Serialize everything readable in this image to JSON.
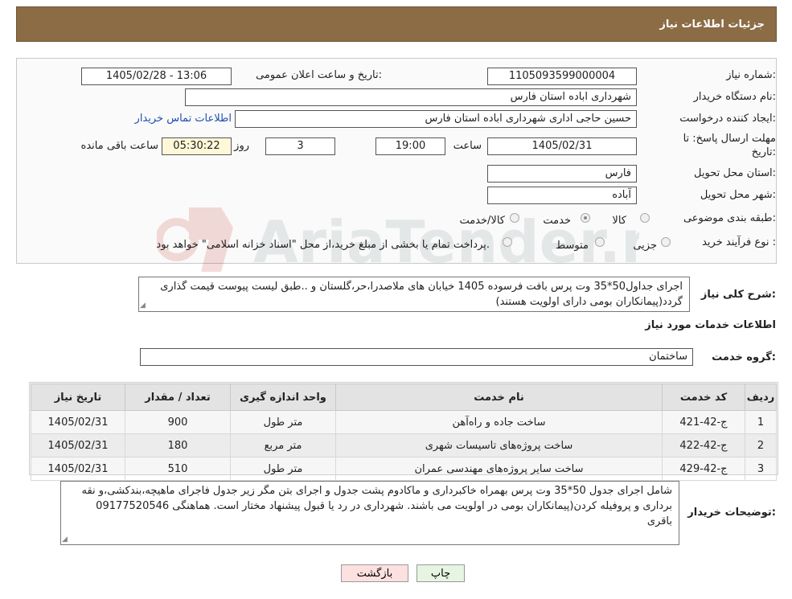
{
  "header": {
    "title": "جزئیات اطلاعات نیاز"
  },
  "need": {
    "number_label": "شماره نیاز:",
    "number_value": "1105093599000004",
    "announce_label": "تاریخ و ساعت اعلان عمومی:",
    "announce_value": "1405/02/28 - 13:06",
    "buyer_label": "نام دستگاه خریدار:",
    "buyer_value": "شهرداری اباده استان فارس",
    "creator_label": "ایجاد کننده درخواست:",
    "creator_value": "حسین حاجی اداری شهرداری اباده استان فارس",
    "contact_link": "اطلاعات تماس خریدار",
    "deadline_label_1": "مهلت ارسال پاسخ: تا",
    "deadline_label_2": "تاریخ:",
    "deadline_date": "1405/02/31",
    "time_label": "ساعت",
    "deadline_time": "19:00",
    "days_value": "3",
    "days_label": "روز و",
    "remaining_value": "05:30:22",
    "remaining_label": "ساعت باقی مانده",
    "province_label": "استان محل تحویل:",
    "province_value": "فارس",
    "city_label": "شهر محل تحویل:",
    "city_value": "آباده",
    "category_label": "طبقه بندی موضوعی:",
    "category_options": [
      "کالا",
      "خدمت",
      "کالا/خدمت"
    ],
    "category_selected": "خدمت",
    "process_label": "نوع فرآیند خرید :",
    "process_options": [
      "جزیی",
      "متوسط"
    ],
    "process_note": "پرداخت تمام یا بخشی از مبلغ خرید،از محل \"اسناد خزانه اسلامی\" خواهد بود."
  },
  "summary": {
    "label": "شرح کلی نیاز:",
    "value": "اجرای جداول50*35 وت پرس بافت فرسوده 1405 خیابان های ملاصدرا،حر،گلستان و ..طبق لیست پیوست قیمت گذاری گردد(پیمانکاران بومی دارای اولویت هستند)"
  },
  "services": {
    "section_title": "اطلاعات خدمات مورد نیاز",
    "group_label": "گروه خدمت:",
    "group_value": "ساختمان",
    "columns": [
      "ردیف",
      "کد خدمت",
      "نام خدمت",
      "واحد اندازه گیری",
      "تعداد / مقدار",
      "تاریخ نیاز"
    ],
    "rows": [
      {
        "index": "1",
        "code": "ج-42-421",
        "name": "ساخت جاده و راه‌آهن",
        "unit": "متر طول",
        "qty": "900",
        "date": "1405/02/31"
      },
      {
        "index": "2",
        "code": "ج-42-422",
        "name": "ساخت پروژه‌های تاسیسات شهری",
        "unit": "متر مربع",
        "qty": "180",
        "date": "1405/02/31"
      },
      {
        "index": "3",
        "code": "ج-42-429",
        "name": "ساخت سایر پروژه‌های مهندسی عمران",
        "unit": "متر طول",
        "qty": "510",
        "date": "1405/02/31"
      }
    ]
  },
  "buyer_notes": {
    "label": "توضیحات خریدار:",
    "value": "شامل اجرای جدول 50*35 وت پرس بهمراه خاکبرداری و ماکادوم پشت جدول و اجرای بتن مگر زیر جدول فاجرای ماهیچه،بندکشی،و نقه برداری و پروفیله کردن(پیمانکاران بومی در اولویت می باشند. شهرداری در رد یا قبول پیشنهاد مختار است. هماهنگی 09177520546 باقری"
  },
  "actions": {
    "print": "چاپ",
    "back": "بازگشت"
  },
  "watermark": {
    "text": "AriaTender.neT"
  },
  "colors": {
    "header_bg": "#8b6c45",
    "link": "#1f4fb0",
    "print_bg": "#e6f5e1",
    "back_bg": "#fde0e0"
  }
}
